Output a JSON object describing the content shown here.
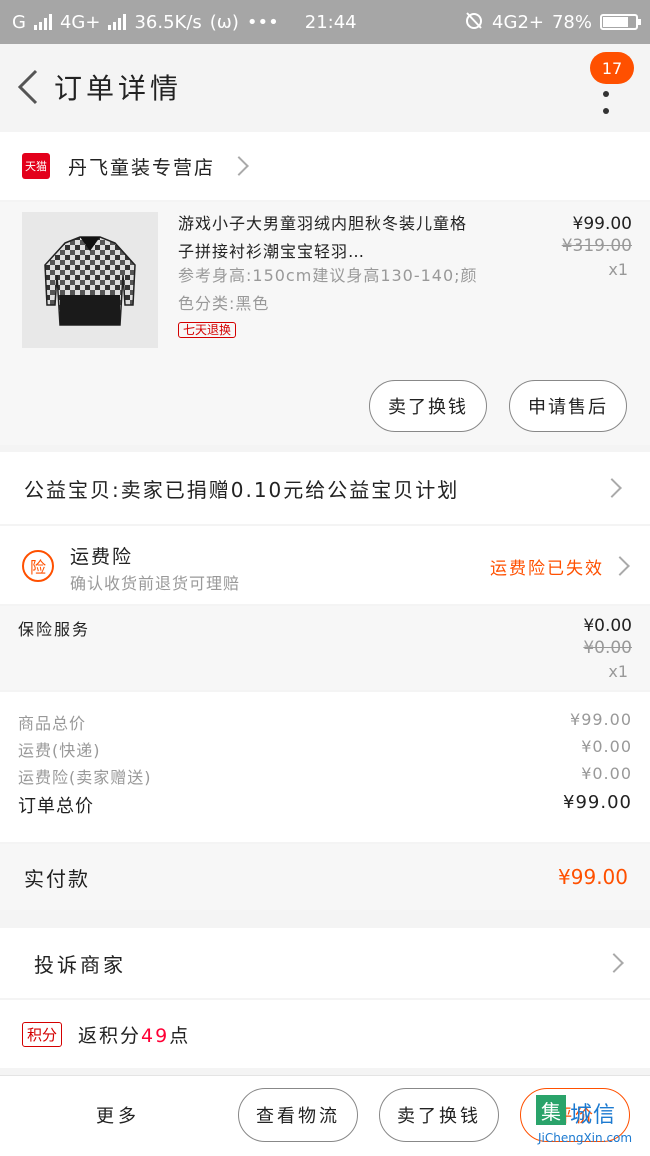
{
  "status_bar": {
    "carrier": "G",
    "network": "4G+",
    "speed": "36.5K/s",
    "extra": "(ω)",
    "dots": "•••",
    "time": "21:44",
    "network_right": "4G2+",
    "battery": "78%",
    "battery_level": 0.78
  },
  "header": {
    "title": "订单详情",
    "badge_count": "17"
  },
  "shop": {
    "tmall_logo": "天猫",
    "name": "丹飞童装专营店"
  },
  "item": {
    "title": "游戏小子大男童羽绒内胆秋冬装儿童格子拼接衬衫潮宝宝轻羽…",
    "sku": "参考身高:150cm建议身高130-140;颜色分类:黑色",
    "return_tag": "七天退换",
    "price": "¥99.00",
    "original_price": "¥319.00",
    "quantity": "x1",
    "btn_refund": "卖了换钱",
    "btn_aftersale": "申请售后"
  },
  "charity": {
    "text": "公益宝贝:卖家已捐赠0.10元给公益宝贝计划"
  },
  "insurance": {
    "icon_text": "险",
    "title": "运费险",
    "subtitle": "确认收货前退货可理赔",
    "status": "运费险已失效"
  },
  "service": {
    "label": "保险服务",
    "price": "¥0.00",
    "original_price": "¥0.00",
    "quantity": "x1"
  },
  "summary": {
    "goods_label": "商品总价",
    "goods_value": "¥99.00",
    "shipping_label": "运费(快递)",
    "shipping_value": "¥0.00",
    "insure_label": "运费险(卖家赠送)",
    "insure_value": "¥0.00",
    "total_label": "订单总价",
    "total_value": "¥99.00"
  },
  "paid": {
    "label": "实付款",
    "value": "¥99.00"
  },
  "complain": {
    "label": "投诉商家"
  },
  "points": {
    "badge": "积分",
    "prefix": "返积分",
    "count": "49",
    "suffix": "点"
  },
  "bottom": {
    "more": "更多",
    "btn_logistics": "查看物流",
    "btn_exchange": "卖了换钱",
    "btn_review": "评价"
  },
  "watermark": {
    "box": "集",
    "brand": "城信",
    "url": "JiChengXin.com"
  },
  "colors": {
    "accent": "#ff5000",
    "tmall_red": "#e3001b"
  }
}
